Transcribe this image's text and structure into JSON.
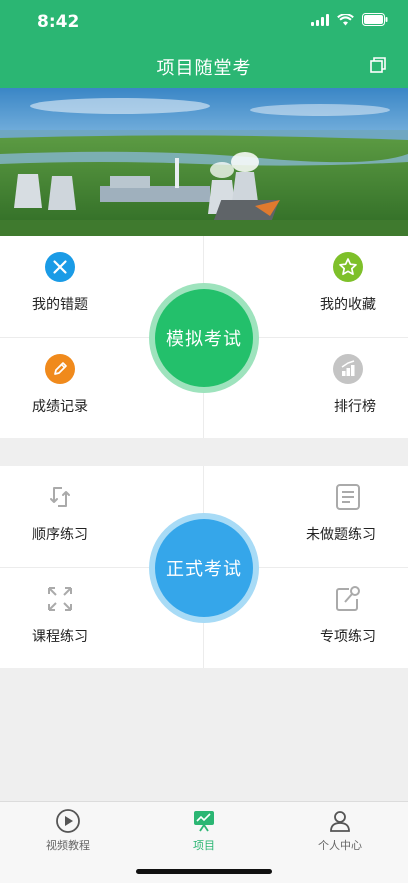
{
  "status": {
    "time": "8:42"
  },
  "header": {
    "title": "项目随堂考"
  },
  "mock": {
    "center": "模拟考试",
    "tiles": [
      {
        "label": "我的错题",
        "icon": "close-circle-icon"
      },
      {
        "label": "我的收藏",
        "icon": "star-icon"
      },
      {
        "label": "成绩记录",
        "icon": "pencil-icon"
      },
      {
        "label": "排行榜",
        "icon": "ranking-icon"
      }
    ]
  },
  "formal": {
    "center": "正式考试",
    "tiles": [
      {
        "label": "顺序练习",
        "icon": "sequence-icon"
      },
      {
        "label": "未做题练习",
        "icon": "document-icon"
      },
      {
        "label": "课程练习",
        "icon": "expand-icon"
      },
      {
        "label": "专项练习",
        "icon": "edit-box-icon"
      }
    ]
  },
  "tabs": [
    {
      "label": "视频教程",
      "icon": "play-circle-icon"
    },
    {
      "label": "项目",
      "icon": "presentation-icon",
      "active": true
    },
    {
      "label": "个人中心",
      "icon": "user-icon"
    }
  ],
  "colors": {
    "primary": "#2bb673",
    "mock": "#23c06b",
    "formal": "#35a6ea"
  }
}
